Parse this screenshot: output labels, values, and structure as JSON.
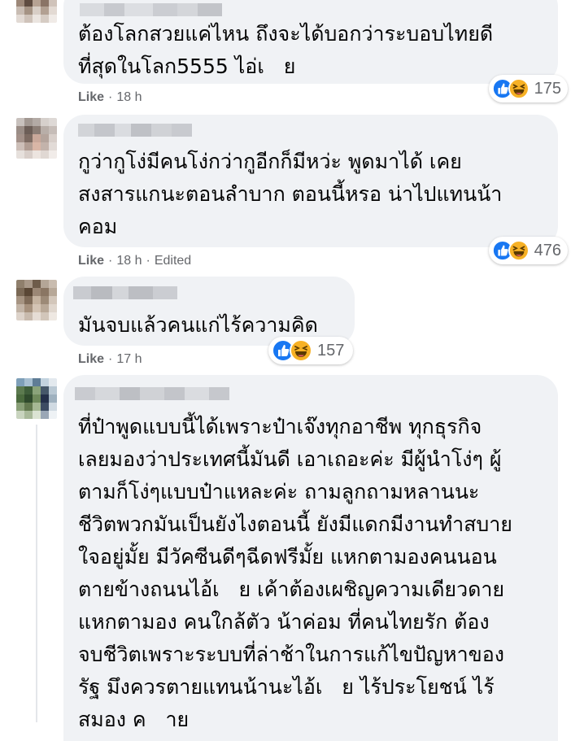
{
  "comments": [
    {
      "text": "ต้องโลกสวยแค่ไหน ถึงจะได้บอกว่าระบอบไทยดี\nที่สุดในโลก5555 ไอ่เ   ย",
      "like_label": "Like",
      "time": "18 h",
      "edited": "",
      "reaction_count": "175",
      "reaction_icons": [
        "like-icon",
        "haha-icon"
      ]
    },
    {
      "text": "กูว่ากูโง่มีคนโง่กว่ากูอีกก็มีหว่ะ พูดมาได้ เคย\nสงสารแกนะตอนลำบาก ตอนนี้หรอ น่าไปแทนน้า\nคอม",
      "like_label": "Like",
      "time": "18 h",
      "edited": "Edited",
      "reaction_count": "476",
      "reaction_icons": [
        "like-icon",
        "haha-icon"
      ]
    },
    {
      "text": "มันจบแล้วคนแก่ไร้ความคิด",
      "like_label": "Like",
      "time": "17 h",
      "edited": "",
      "reaction_count": "157",
      "reaction_icons": [
        "like-icon",
        "haha-icon"
      ]
    },
    {
      "text": "ที่ป๋าพูดแบบนี้ได้เพราะป๋าเจ๊งทุกอาชีพ ทุกธุรกิจ\nเลยมองว่าประเทศนี้มันดี เอาเถอะค่ะ มีผู้นำโง่ๆ ผู้\nตามก็โง่ๆแบบป๋าแหละค่ะ ถามลูกถามหลานนะ\nชีวิตพวกมันเป็นยังไงตอนนี้ ยังมีแดกมีงานทำสบาย\nใจอยู่มั้ย มีวัคซีนดีๆฉีดฟรีมั้ย แหกตามองคนนอน\nตายข้างถนนไอ้เ   ย เค้าต้องเผชิญความเดียวดาย\nแหกตามอง คนใกล้ตัว น้าค่อม ที่คนไทยรัก ต้อง\nจบชีวิตเพราะระบบที่ล่าช้าในการแก้ไขปัญหาของ\nรัฐ มึงควรตายแทนน้านะไอ้เ   ย ไร้ประโยชน์ ไร้\nสมอง ค   าย"
    }
  ],
  "colors": {
    "bubble": "#f0f2f5",
    "meta_text": "#65676b",
    "like_blue": "#1877f2",
    "haha_yellow": "#f7b125"
  }
}
